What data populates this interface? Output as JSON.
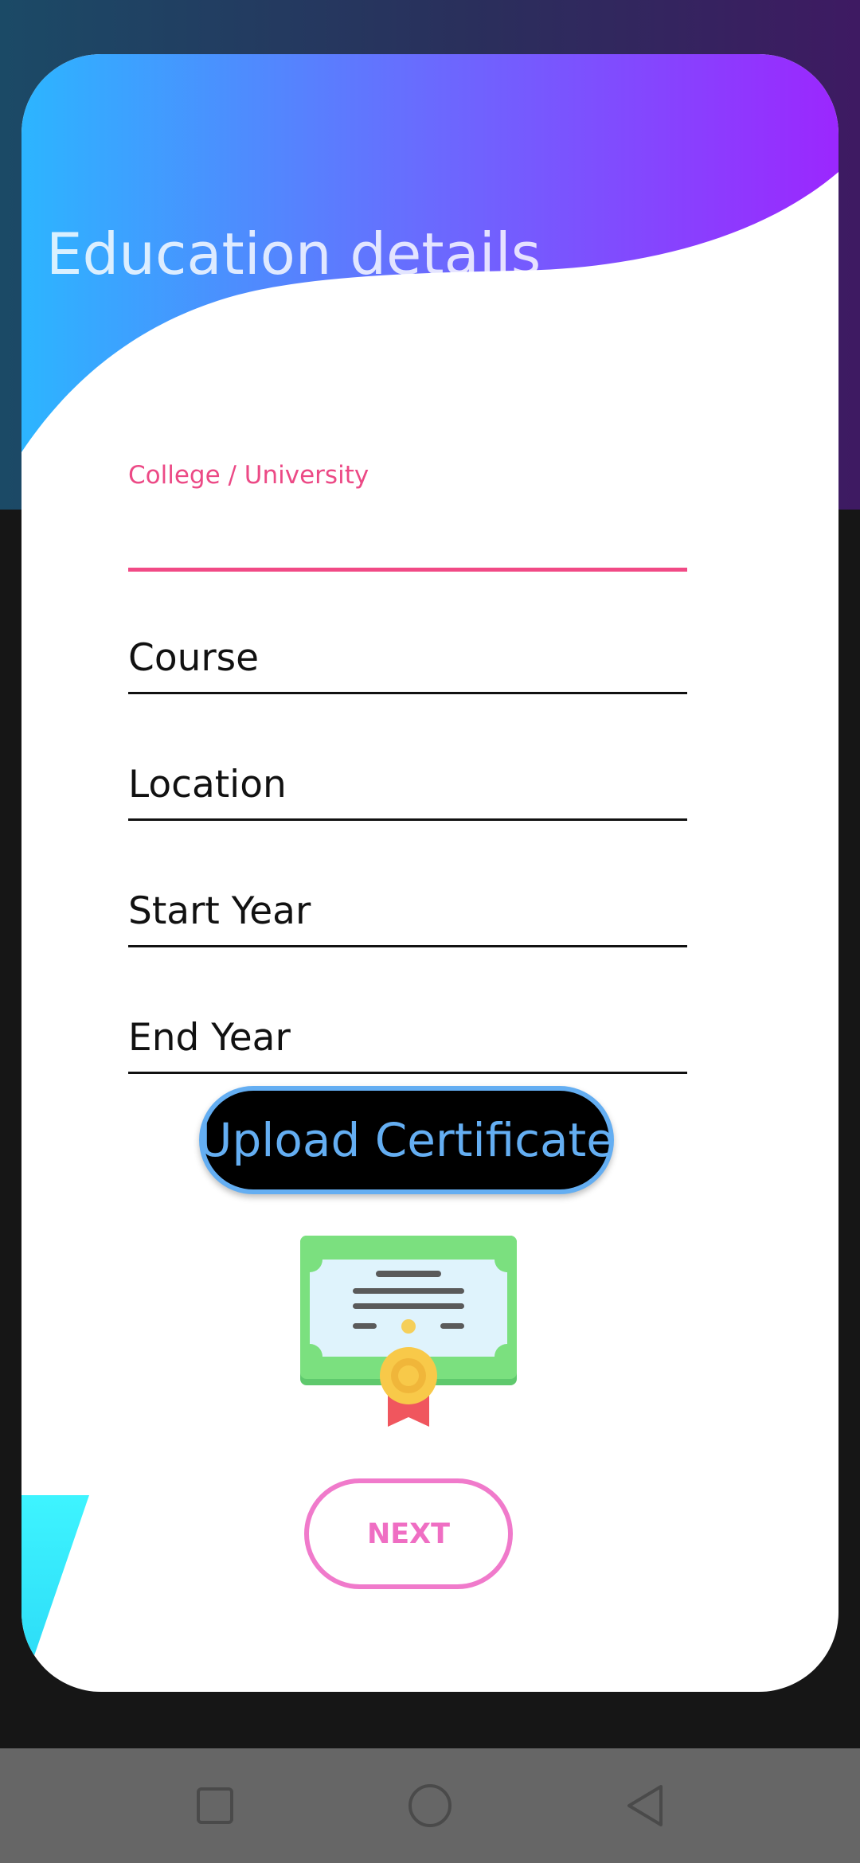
{
  "page": {
    "title": "Education details"
  },
  "form": {
    "college_label": "College / University",
    "college_value": "",
    "course_placeholder": "Course",
    "location_placeholder": "Location",
    "start_year_placeholder": "Start Year",
    "end_year_placeholder": "End Year"
  },
  "actions": {
    "upload_label": "Upload Certificate",
    "next_label": "NEXT"
  },
  "icons": {
    "certificate": "certificate-icon",
    "recents": "square-icon",
    "home": "circle-icon",
    "back": "triangle-back-icon"
  },
  "colors": {
    "accent_pink": "#f14a86",
    "upload_blue": "#64aef2",
    "next_pink": "#f07acb",
    "header_gradient_start": "#2cb5ff",
    "header_gradient_end": "#9b27fe"
  }
}
